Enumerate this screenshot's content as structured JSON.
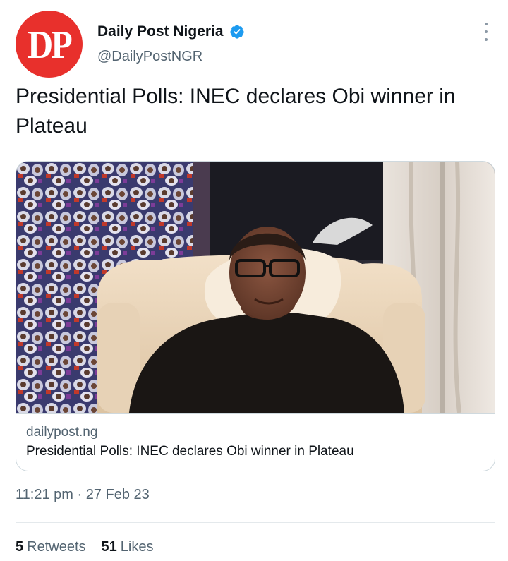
{
  "tweet": {
    "avatar_text": "DP",
    "display_name": "Daily Post Nigeria",
    "handle": "@DailyPostNGR",
    "text": "Presidential Polls: INEC declares Obi winner in Plateau",
    "time": "11:21 pm",
    "separator": "·",
    "date": "27 Feb 23"
  },
  "card": {
    "domain": "dailypost.ng",
    "title": "Presidential Polls: INEC declares Obi winner in Plateau",
    "image_icon": "photo-of-man-in-armchair"
  },
  "stats": {
    "retweets_count": "5",
    "retweets_label": "Retweets",
    "likes_count": "51",
    "likes_label": "Likes"
  },
  "colors": {
    "brand_red": "#e8302c",
    "verified_blue": "#1d9bf0",
    "secondary_text": "#536471"
  },
  "icons": {
    "verified": "verified-badge-icon",
    "more": "more-options-icon"
  }
}
